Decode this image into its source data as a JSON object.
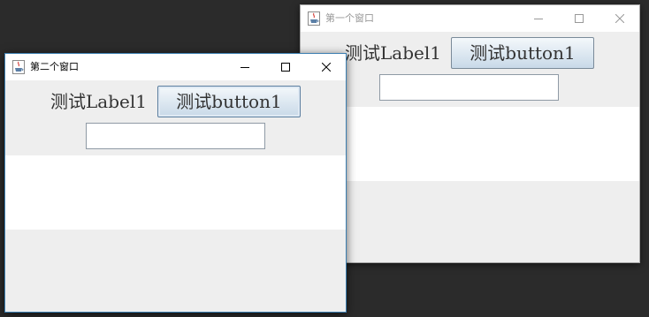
{
  "desktop": {
    "background_color": "#2b2b2b"
  },
  "windows": {
    "back": {
      "title": "第一个窗口",
      "icon": "java-cup-icon",
      "label": "测试Label1",
      "button_label": "测试button1",
      "text_field_value": "",
      "active": false
    },
    "front": {
      "title": "第二个窗口",
      "icon": "java-cup-icon",
      "label": "测试Label1",
      "button_label": "测试button1",
      "text_field_value": "",
      "active": true
    }
  },
  "colors": {
    "active_border": "#3c7fb1",
    "button_gradient_top": "#f4f8fb",
    "button_gradient_bottom": "#c8d9e8"
  }
}
